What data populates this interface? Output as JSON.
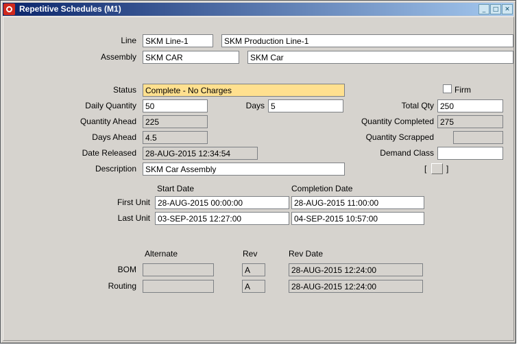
{
  "window": {
    "title": "Repetitive Schedules (M1)",
    "icons": {
      "minimize": "_",
      "maximize": "□",
      "close": "✕"
    }
  },
  "colors": {
    "titlebar-start": "#0a246a",
    "titlebar-end": "#a6caf0",
    "status-bg": "#ffe08f",
    "oracle-red": "#d0291d",
    "window-bg": "#d6d3ce"
  },
  "fields": {
    "line": {
      "label": "Line",
      "code": "SKM Line-1",
      "name": "SKM Production Line-1"
    },
    "assembly": {
      "label": "Assembly",
      "code": "SKM CAR",
      "name": "SKM Car"
    },
    "status": {
      "label": "Status",
      "value": "Complete - No Charges"
    },
    "firm": {
      "label": "Firm"
    },
    "daily_quantity": {
      "label": "Daily Quantity",
      "value": "50"
    },
    "days": {
      "label": "Days",
      "value": "5"
    },
    "total_qty": {
      "label": "Total Qty",
      "value": "250"
    },
    "quantity_ahead": {
      "label": "Quantity Ahead",
      "value": "225"
    },
    "quantity_completed": {
      "label": "Quantity Completed",
      "value": "275"
    },
    "days_ahead": {
      "label": "Days Ahead",
      "value": "4.5"
    },
    "quantity_scrapped": {
      "label": "Quantity Scrapped",
      "value": ""
    },
    "date_released": {
      "label": "Date Released",
      "value": "28-AUG-2015 12:34:54"
    },
    "demand_class": {
      "label": "Demand Class",
      "value": ""
    },
    "description": {
      "label": "Description",
      "value": "SKM Car Assembly",
      "flex_open": "[",
      "flex_close": "]"
    },
    "unit_dates": {
      "start_header": "Start Date",
      "completion_header": "Completion Date",
      "first_unit": {
        "label": "First Unit",
        "start": "28-AUG-2015 00:00:00",
        "completion": "28-AUG-2015 11:00:00"
      },
      "last_unit": {
        "label": "Last Unit",
        "start": "03-SEP-2015 12:27:00",
        "completion": "04-SEP-2015 10:57:00"
      }
    },
    "bom_section": {
      "alternate_header": "Alternate",
      "rev_header": "Rev",
      "rev_date_header": "Rev Date",
      "bom": {
        "label": "BOM",
        "alternate": "",
        "rev": "A",
        "rev_date": "28-AUG-2015 12:24:00"
      },
      "routing": {
        "label": "Routing",
        "alternate": "",
        "rev": "A",
        "rev_date": "28-AUG-2015 12:24:00"
      }
    }
  }
}
